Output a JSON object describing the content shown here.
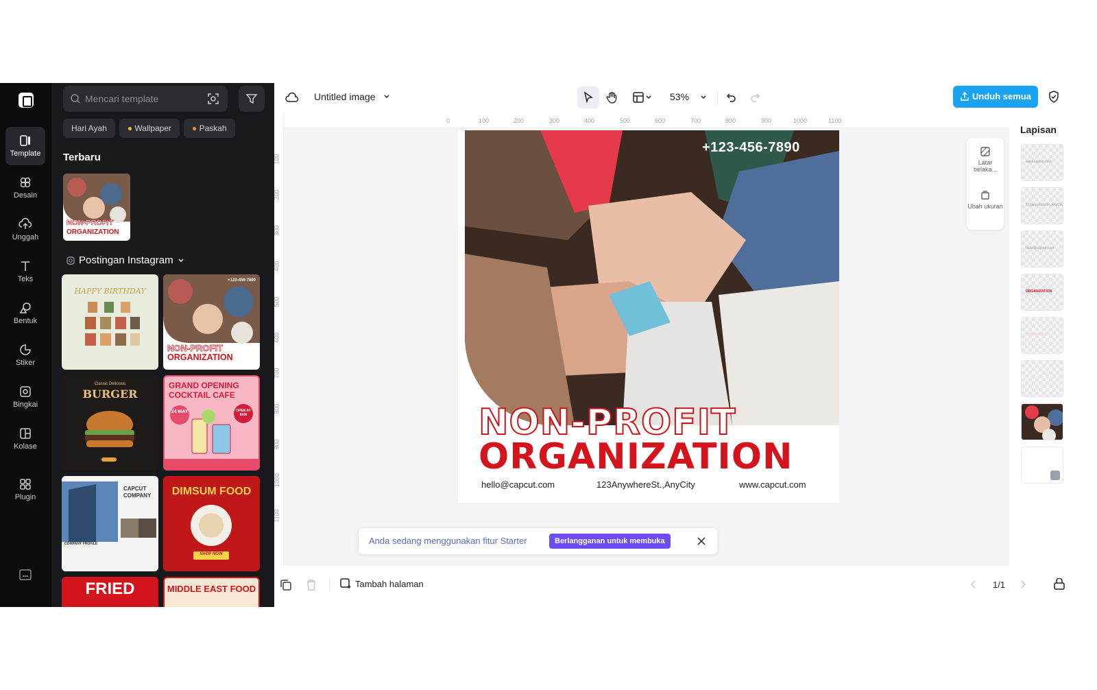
{
  "rail": {
    "items": [
      {
        "label": "Template",
        "icon": "template-icon",
        "active": true
      },
      {
        "label": "Desain",
        "icon": "design-icon"
      },
      {
        "label": "Unggah",
        "icon": "upload-icon"
      },
      {
        "label": "Teks",
        "icon": "text-icon"
      },
      {
        "label": "Bentuk",
        "icon": "shape-icon"
      },
      {
        "label": "Stiker",
        "icon": "sticker-icon"
      },
      {
        "label": "Bingkai",
        "icon": "frame-icon"
      },
      {
        "label": "Kolase",
        "icon": "collage-icon"
      },
      {
        "label": "Plugin",
        "icon": "plugin-icon"
      }
    ]
  },
  "panel": {
    "search_placeholder": "Mencari template",
    "chips": [
      "Hari Ayah",
      "Wallpaper",
      "Paskah"
    ],
    "recent_title": "Terbaru",
    "recent_thumb": {
      "line1": "NON-PROFIT",
      "line2": "ORGANIZATION"
    },
    "category_title": "Postingan Instagram",
    "templates": [
      {
        "name": "birthday",
        "title": "HAPPY BIRTHDAY"
      },
      {
        "name": "nonprofit",
        "line1": "NON-PROFIT",
        "line2": "ORGANIZATION",
        "phone": "+123-456-7890"
      },
      {
        "name": "burger",
        "pre": "Classic Delicious",
        "title": "BURGER"
      },
      {
        "name": "cocktail",
        "title1": "GRAND OPENING",
        "title2": "COCKTAIL CAFE",
        "date": "24 MAY",
        "badge": "OPEN AT 8AM"
      },
      {
        "name": "company",
        "title1": "CAPCUT",
        "title2": "COMPANY",
        "footer": "COMPANY PROFILE"
      },
      {
        "name": "dimsum",
        "title": "DIMSUM FOOD",
        "cta": "SHOP NOW"
      },
      {
        "name": "fried",
        "title": "FRIED"
      },
      {
        "name": "middleeast",
        "title": "MIDDLE EAST FOOD"
      }
    ]
  },
  "topbar": {
    "doc_title": "Untitled image",
    "zoom": "53%",
    "download_label": "Unduh semua"
  },
  "rulers": {
    "h_ticks": [
      "0",
      "100",
      "200",
      "300",
      "400",
      "500",
      "600",
      "700",
      "800",
      "900",
      "1000",
      "1100"
    ],
    "v_ticks": [
      "100",
      "200",
      "300",
      "400",
      "500",
      "600",
      "700",
      "800",
      "900",
      "1000",
      "1100"
    ]
  },
  "canvas": {
    "phone": "+123-456-7890",
    "title_line1": "NON-PROFIT",
    "title_line2": "ORGANIZATION",
    "email": "hello@capcut.com",
    "address": "123AnywhereSt.,AnyCity",
    "website": "www.capcut.com"
  },
  "sidetools": {
    "background_label": "Latar belaka...",
    "resize_label": "Ubah ukuran"
  },
  "layers": {
    "title": "Lapisan",
    "items": [
      {
        "text": "www.capcut.com"
      },
      {
        "text": "123anywhereSt.,AnyCity"
      },
      {
        "text": "hello@capcut.com"
      },
      {
        "text": "ORGANIZATION"
      },
      {
        "text": "NON-PROFIT"
      },
      {
        "text": "+123-456-7890"
      },
      {
        "text": ""
      },
      {
        "text": ""
      }
    ]
  },
  "banner": {
    "text": "Anda sedang menggunakan fitur Starter",
    "button": "Berlangganan untuk membuka"
  },
  "bottombar": {
    "add_page": "Tambah halaman",
    "pager": "1/1"
  },
  "colors": {
    "accent_blue": "#1aa3f2",
    "brand_red": "#d3141c",
    "purple": "#6d4cf2",
    "panel_bg": "#18191c"
  }
}
